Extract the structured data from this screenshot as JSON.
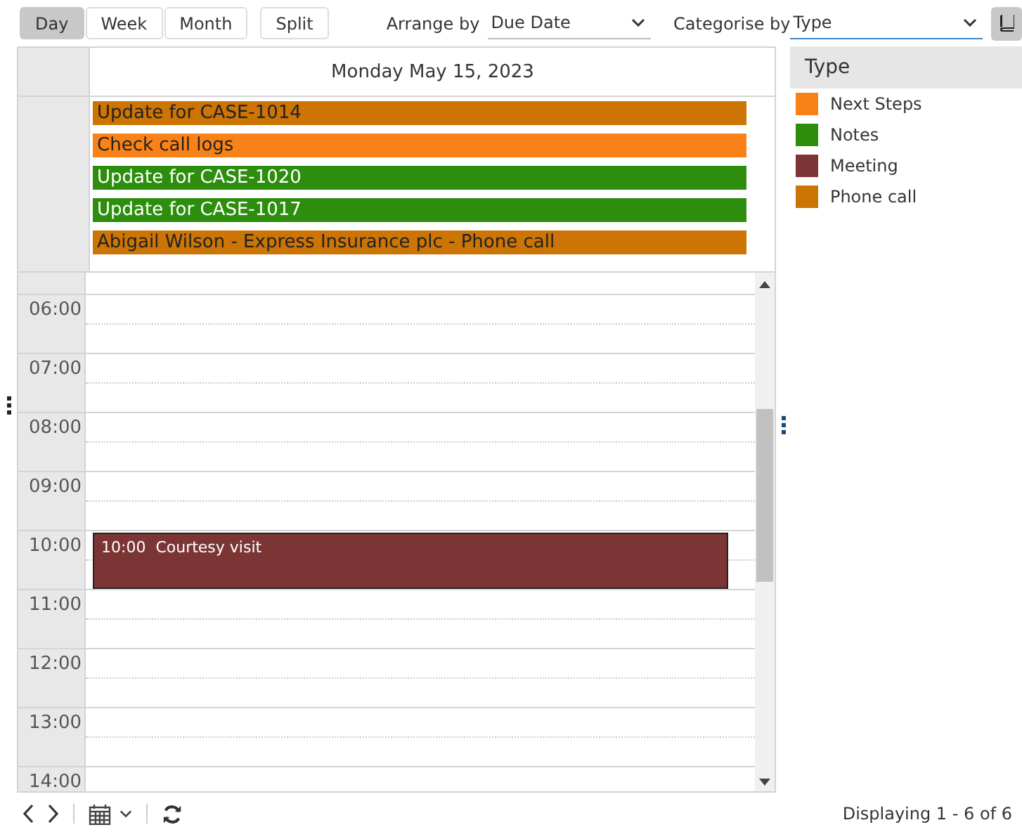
{
  "toolbar": {
    "views": [
      {
        "label": "Day",
        "selected": true
      },
      {
        "label": "Week",
        "selected": false
      },
      {
        "label": "Month",
        "selected": false
      }
    ],
    "split": "Split",
    "arrange_by": {
      "label": "Arrange by",
      "value": "Due Date"
    },
    "categorise_by": {
      "label": "Categorise by",
      "value": "Type"
    }
  },
  "calendar": {
    "day_header": "Monday May 15, 2023",
    "all_day_events": [
      {
        "title": "Update for CASE-1014",
        "color": "#cc7404"
      },
      {
        "title": "Check call logs",
        "color": "#f88217"
      },
      {
        "title": "Update for CASE-1020",
        "color": "#2d8e0e"
      },
      {
        "title": "Update for CASE-1017",
        "color": "#2d8e0e"
      },
      {
        "title": "Abigail Wilson - Express Insurance plc - Phone call",
        "color": "#cc7404"
      }
    ],
    "hours": [
      "06:00",
      "07:00",
      "08:00",
      "09:00",
      "10:00",
      "11:00",
      "12:00",
      "13:00",
      "14:00"
    ],
    "timed_events": [
      {
        "time": "10:00",
        "title": "Courtesy visit",
        "color": "#7b3535"
      }
    ]
  },
  "legend": {
    "title": "Type",
    "items": [
      {
        "label": "Next Steps",
        "color": "#f88217"
      },
      {
        "label": "Notes",
        "color": "#2d8e0e"
      },
      {
        "label": "Meeting",
        "color": "#7b3535"
      },
      {
        "label": "Phone call",
        "color": "#cc7404"
      }
    ]
  },
  "status_bar": {
    "summary": "Displaying 1 - 6 of 6"
  }
}
